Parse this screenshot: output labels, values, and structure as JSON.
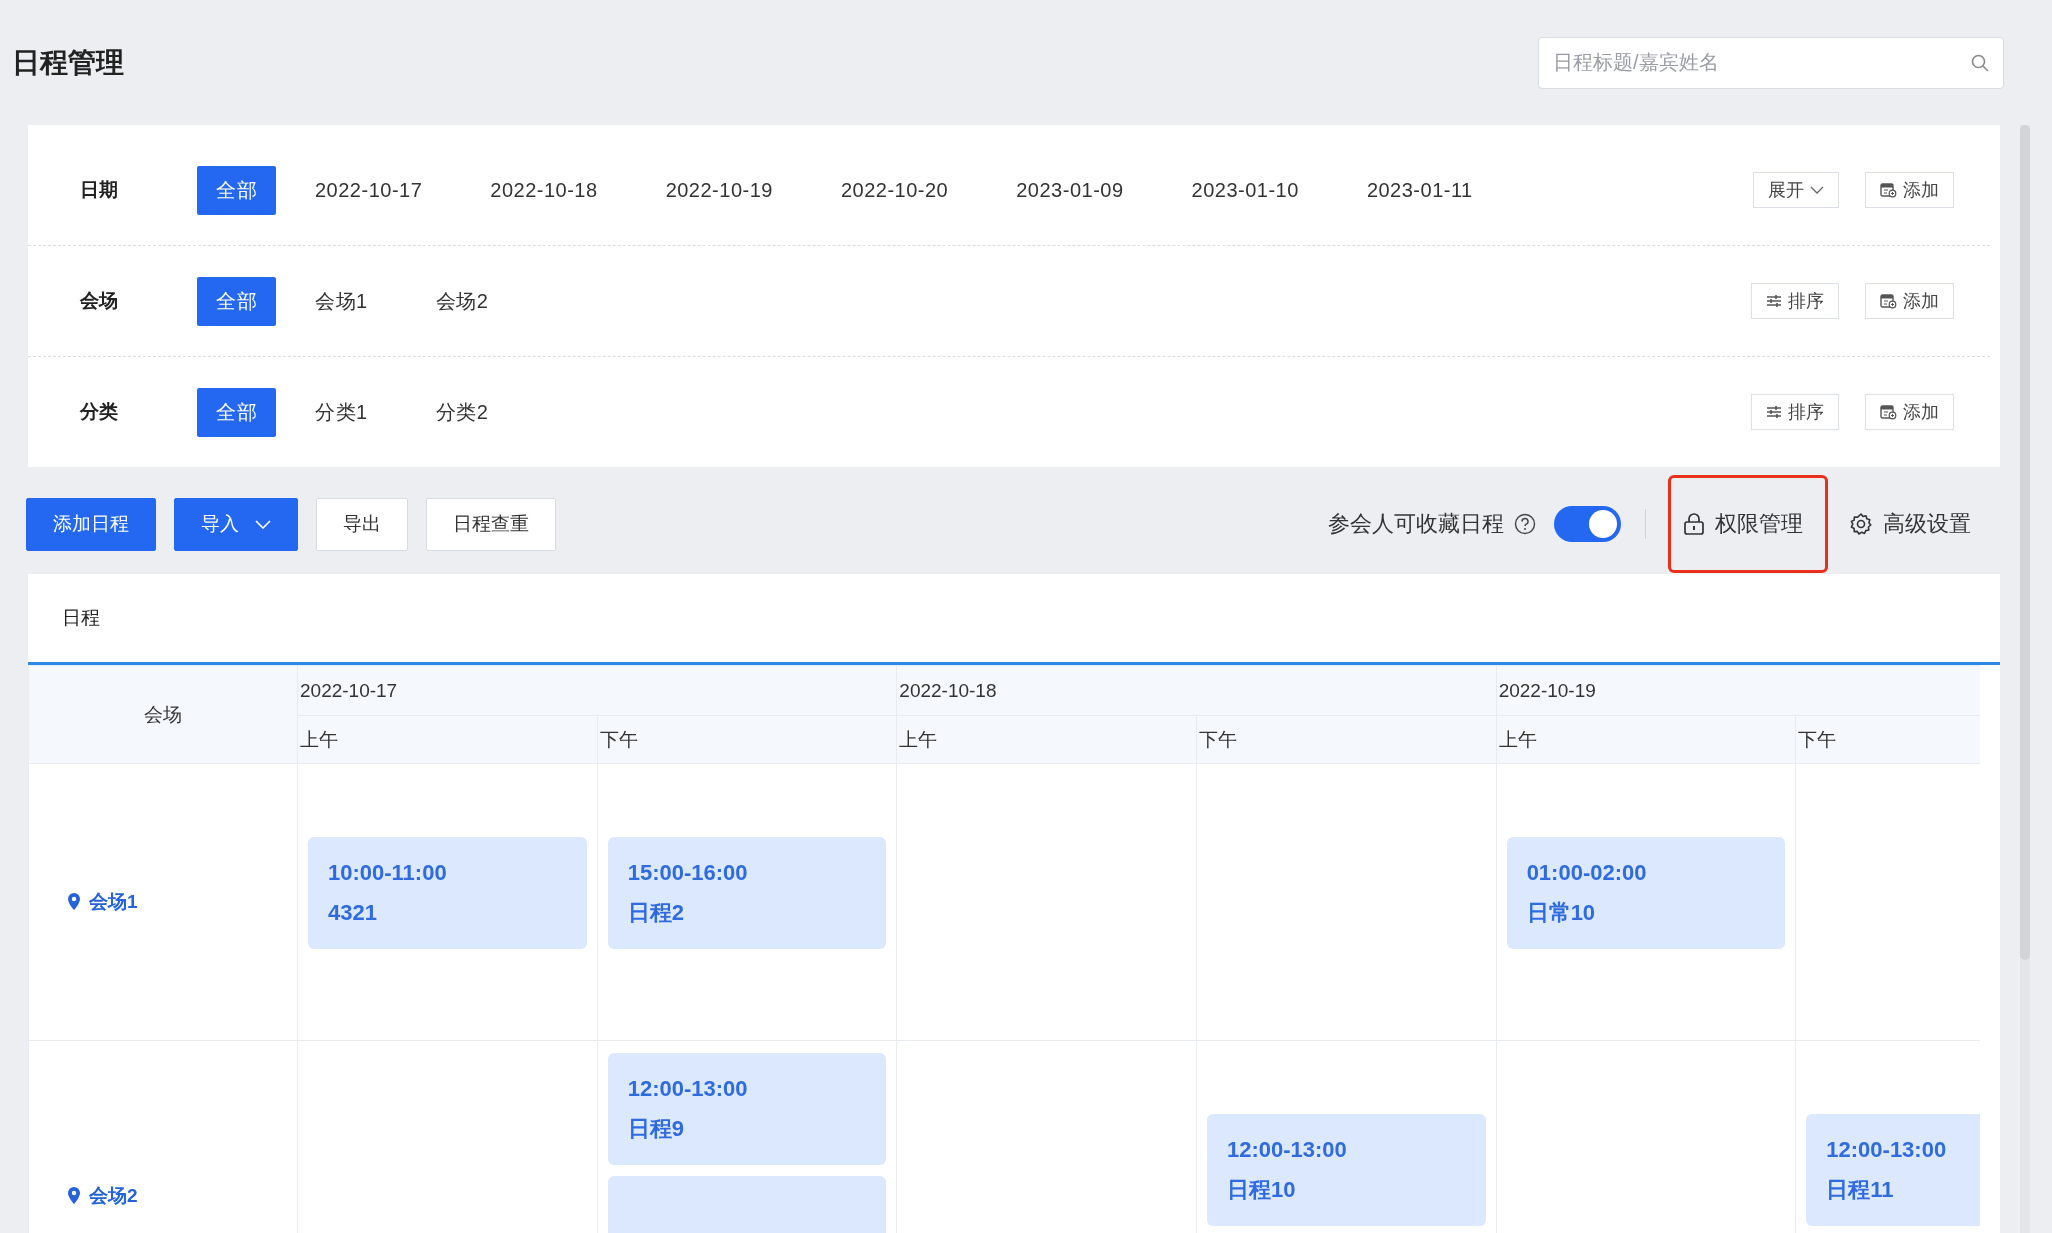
{
  "page_title": "日程管理",
  "search": {
    "placeholder": "日程标题/嘉宾姓名"
  },
  "filters": [
    {
      "label": "日期",
      "options": [
        {
          "text": "全部",
          "selected": true
        },
        {
          "text": "2022-10-17",
          "selected": false
        },
        {
          "text": "2022-10-18",
          "selected": false
        },
        {
          "text": "2022-10-19",
          "selected": false
        },
        {
          "text": "2022-10-20",
          "selected": false
        },
        {
          "text": "2023-01-09",
          "selected": false
        },
        {
          "text": "2023-01-10",
          "selected": false
        },
        {
          "text": "2023-01-11",
          "selected": false
        }
      ],
      "actions": [
        {
          "kind": "expand",
          "text": "展开"
        },
        {
          "kind": "add",
          "text": "添加"
        }
      ]
    },
    {
      "label": "会场",
      "options": [
        {
          "text": "全部",
          "selected": true
        },
        {
          "text": "会场1",
          "selected": false
        },
        {
          "text": "会场2",
          "selected": false
        }
      ],
      "actions": [
        {
          "kind": "sort",
          "text": "排序"
        },
        {
          "kind": "add",
          "text": "添加"
        }
      ]
    },
    {
      "label": "分类",
      "options": [
        {
          "text": "全部",
          "selected": true
        },
        {
          "text": "分类1",
          "selected": false
        },
        {
          "text": "分类2",
          "selected": false
        }
      ],
      "actions": [
        {
          "kind": "sort",
          "text": "排序"
        },
        {
          "kind": "add",
          "text": "添加"
        }
      ]
    }
  ],
  "toolbar": {
    "buttons": [
      {
        "kind": "primary",
        "text": "添加日程"
      },
      {
        "kind": "dropdown",
        "text": "导入"
      },
      {
        "kind": "default",
        "text": "导出"
      },
      {
        "kind": "default",
        "text": "日程查重"
      }
    ],
    "favorite_toggle": {
      "label": "参会人可收藏日程",
      "on": true
    },
    "links": [
      {
        "kind": "permission",
        "text": "权限管理",
        "highlighted": true
      },
      {
        "kind": "settings",
        "text": "高级设置",
        "highlighted": false
      }
    ]
  },
  "schedule": {
    "tab": "日程",
    "venue_heading": "会场",
    "days": [
      {
        "date": "2022-10-17",
        "halves": [
          "上午",
          "下午"
        ]
      },
      {
        "date": "2022-10-18",
        "halves": [
          "上午",
          "下午"
        ]
      },
      {
        "date": "2022-10-19",
        "halves": [
          "上午",
          "下午"
        ]
      }
    ],
    "rows": [
      {
        "venue": "会场1",
        "cells": [
          [
            {
              "kind": "event",
              "time": "10:00-11:00",
              "title": "4321"
            }
          ],
          [
            {
              "kind": "event",
              "time": "15:00-16:00",
              "title": "日程2"
            }
          ],
          [],
          [],
          [
            {
              "kind": "event",
              "time": "01:00-02:00",
              "title": "日常10"
            }
          ],
          []
        ]
      },
      {
        "venue": "会场2",
        "cells": [
          [],
          [
            {
              "kind": "event",
              "time": "12:00-13:00",
              "title": "日程9"
            },
            {
              "kind": "cut"
            }
          ],
          [],
          [
            {
              "kind": "event",
              "time": "12:00-13:00",
              "title": "日程10"
            }
          ],
          [],
          [
            {
              "kind": "event",
              "time": "12:00-13:00",
              "title": "日程11"
            }
          ]
        ]
      }
    ]
  }
}
